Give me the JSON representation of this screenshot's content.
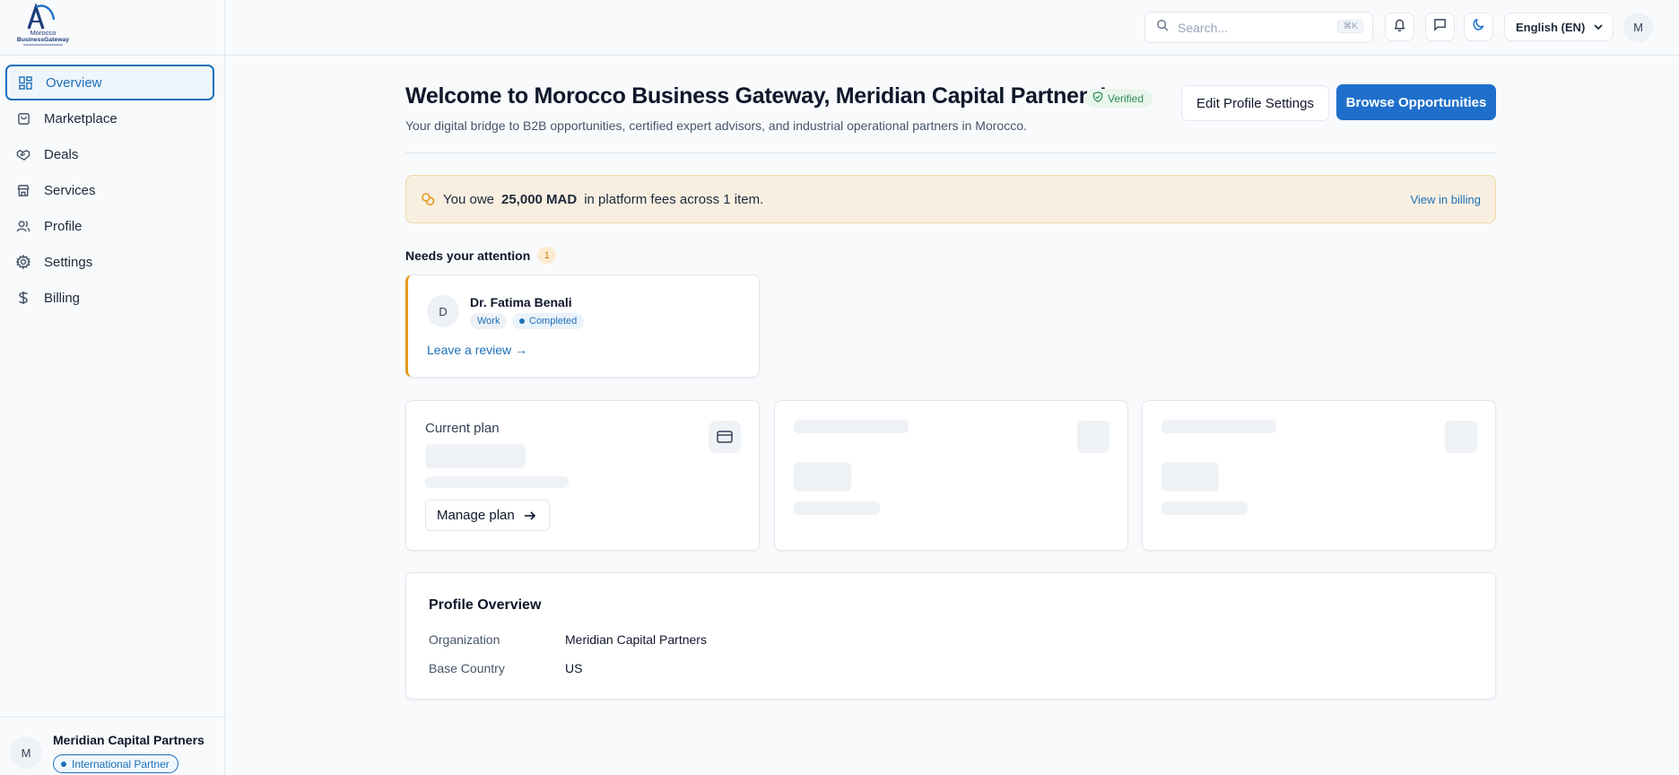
{
  "brand": {
    "logo_line1": "Morocco",
    "logo_line2": "BusinessGateway"
  },
  "sidebar": {
    "items": [
      {
        "label": "Overview",
        "icon": "grid-icon",
        "active": true
      },
      {
        "label": "Marketplace",
        "icon": "shopping-bag-icon"
      },
      {
        "label": "Deals",
        "icon": "handshake-icon"
      },
      {
        "label": "Services",
        "icon": "store-icon"
      },
      {
        "label": "Profile",
        "icon": "users-icon"
      },
      {
        "label": "Settings",
        "icon": "gear-icon"
      },
      {
        "label": "Billing",
        "icon": "dollar-icon"
      }
    ],
    "footer": {
      "avatar": "M",
      "org_name": "Meridian Capital Partners",
      "role_badge": "International Partner"
    }
  },
  "header": {
    "search_placeholder": "Search...",
    "search_shortcut": "⌘K",
    "language": "English (EN)",
    "avatar": "M"
  },
  "welcome": {
    "title": "Welcome to Morocco Business Gateway, Meridian Capital Partners!",
    "verified_label": "Verified",
    "subtitle": "Your digital bridge to B2B opportunities, certified expert advisors, and industrial operational partners in Morocco.",
    "edit_button": "Edit Profile Settings",
    "browse_button": "Browse Opportunities"
  },
  "fee_banner": {
    "prefix": "You owe",
    "amount": "25,000 MAD",
    "suffix": "in platform fees across 1 item.",
    "link": "View in billing"
  },
  "attention": {
    "heading": "Needs your attention",
    "count": "1",
    "card": {
      "avatar": "D",
      "name": "Dr. Fatima Benali",
      "tag_type": "Work",
      "tag_status": "Completed",
      "action": "Leave a review →"
    }
  },
  "plan_card": {
    "label": "Current plan",
    "manage_button": "Manage plan"
  },
  "profile_overview": {
    "heading": "Profile Overview",
    "rows": [
      {
        "key": "Organization",
        "value": "Meridian Capital Partners"
      },
      {
        "key": "Base Country",
        "value": "US"
      }
    ]
  },
  "colors": {
    "accent": "#1e6fcb",
    "warning": "#e39a1c",
    "success": "#2e8b57"
  }
}
